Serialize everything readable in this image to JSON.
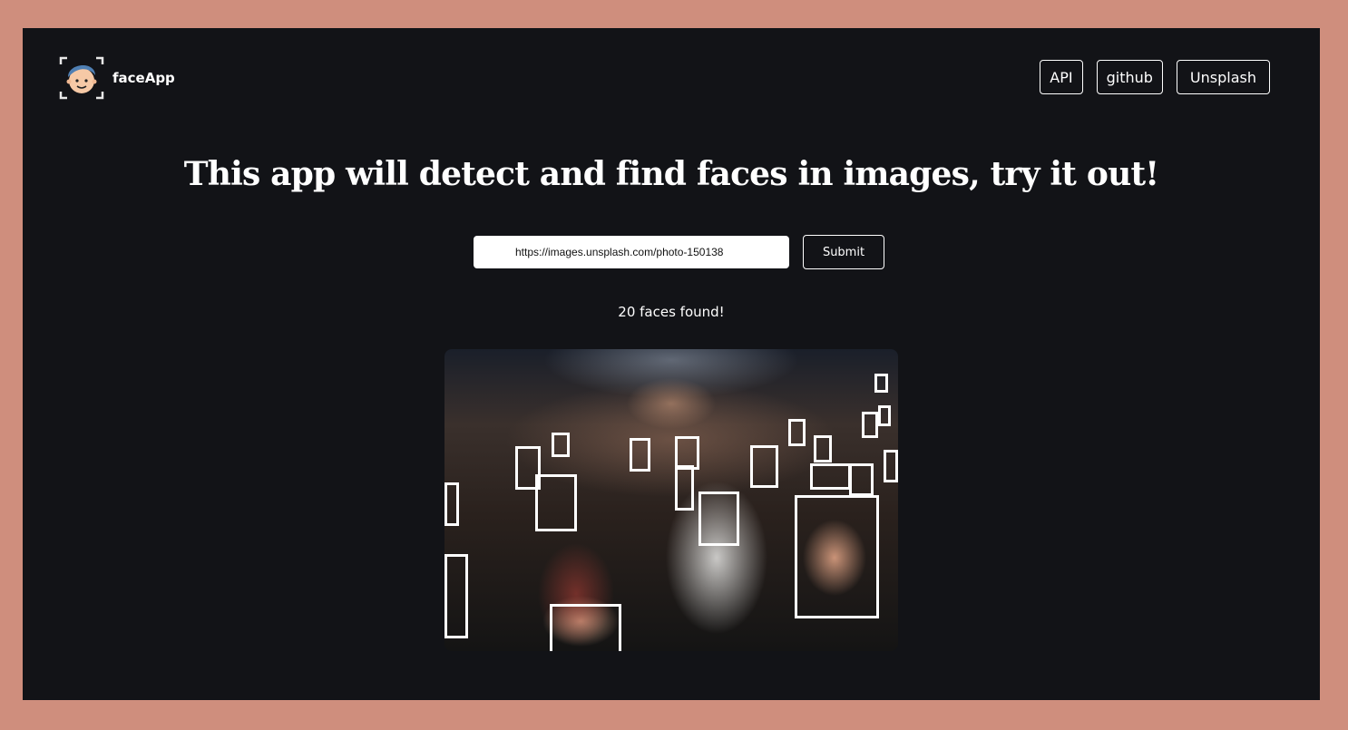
{
  "brand": {
    "name": "faceApp",
    "logo_icon": "face-scan-icon"
  },
  "nav": {
    "items": [
      "API",
      "github",
      "Unsplash"
    ]
  },
  "headline": "This app will detect and find faces in images, try it out!",
  "form": {
    "url_value": "https://images.unsplash.com/photo-150138",
    "submit_label": "Submit"
  },
  "result": {
    "count_text": "20 faces found!",
    "faces_found": 20,
    "image_description_icon": "crowd-photo"
  },
  "colors": {
    "outer_frame": "#cf8e7d",
    "app_background": "#121317",
    "text": "#ffffff",
    "box_stroke": "#ffffff"
  }
}
